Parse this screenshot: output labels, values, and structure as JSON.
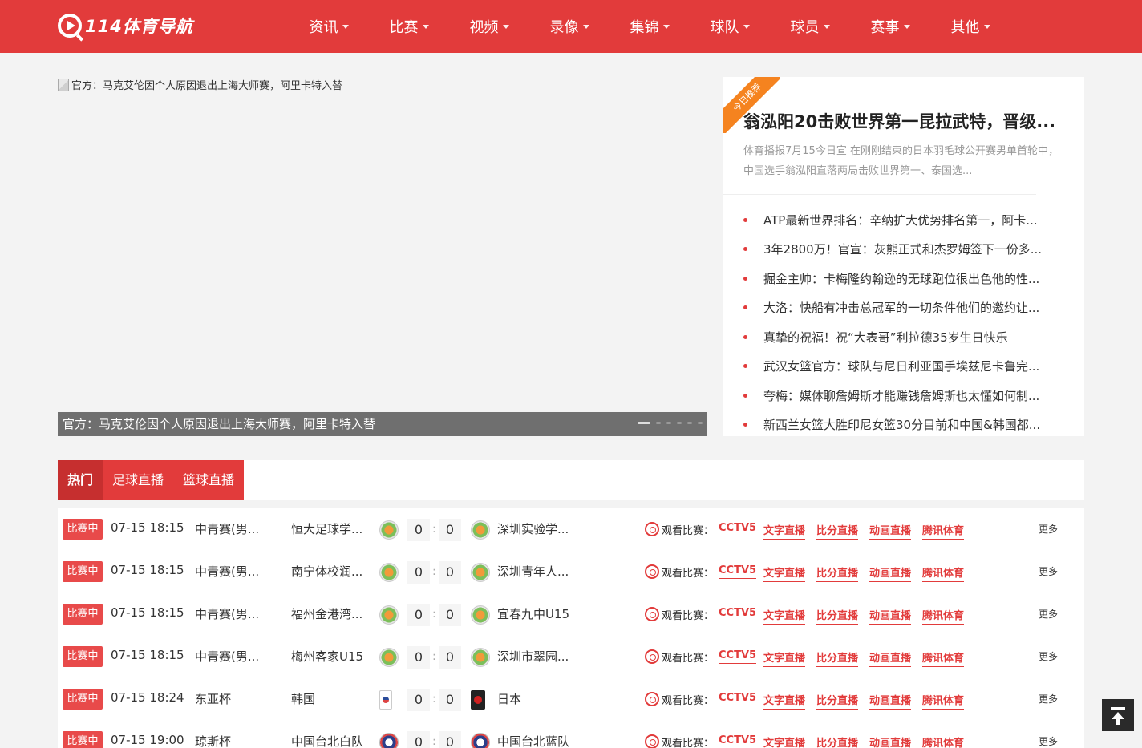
{
  "brand": {
    "logo_text": "114体育导航",
    "accent": "#e23b3b"
  },
  "nav": [
    "资讯",
    "比赛",
    "视频",
    "录像",
    "集锦",
    "球队",
    "球员",
    "赛事",
    "其他"
  ],
  "slider": {
    "image_alt": "官方：马克艾伦因个人原因退出上海大师赛，阿里卡特入替",
    "caption": "官方：马克艾伦因个人原因退出上海大师赛，阿里卡特入替"
  },
  "recommend": {
    "ribbon": "今日推荐",
    "title": "翁泓阳20击败世界第一昆拉武特，晋级...",
    "desc": "体育播报7月15今日宣 在刚刚结束的日本羽毛球公开赛男单首轮中，中国选手翁泓阳直落两局击败世界第一、泰国选...",
    "news": [
      "ATP最新世界排名：辛纳扩大优势排名第一，阿卡...",
      "3年2800万！官宣：灰熊正式和杰罗姆签下一份多...",
      "掘金主帅：卡梅隆约翰逊的无球跑位很出色他的性...",
      "大洛：快船有冲击总冠军的一切条件他们的邀约让...",
      "真挚的祝福！祝“大表哥”利拉德35岁生日快乐",
      "武汉女篮官方：球队与尼日利亚国手埃兹尼卡鲁完...",
      "夸梅：媒体聊詹姆斯才能赚钱詹姆斯也太懂如何制...",
      "新西兰女篮大胜印尼女篮30分目前和中国&韩国都..."
    ]
  },
  "tabs": [
    "热门",
    "足球直播",
    "篮球直播"
  ],
  "match_labels": {
    "watch": "观看比赛：",
    "more": "更多"
  },
  "channels": [
    "CCTV5",
    "文字直播",
    "比分直播",
    "动画直播",
    "腾讯体育"
  ],
  "matches": [
    {
      "status": "比赛中",
      "time": "07-15 18:15",
      "league": "中青赛(男...",
      "home": "恒大足球学...",
      "home_logo": "basketball-logo",
      "home_score": "0",
      "away_score": "0",
      "away": "深圳实验学...",
      "away_logo": "basketball-logo"
    },
    {
      "status": "比赛中",
      "time": "07-15 18:15",
      "league": "中青赛(男...",
      "home": "南宁体校润...",
      "home_logo": "basketball-logo",
      "home_score": "0",
      "away_score": "0",
      "away": "深圳青年人...",
      "away_logo": "basketball-logo"
    },
    {
      "status": "比赛中",
      "time": "07-15 18:15",
      "league": "中青赛(男...",
      "home": "福州金港湾...",
      "home_logo": "basketball-logo",
      "home_score": "0",
      "away_score": "0",
      "away": "宜春九中U15",
      "away_logo": "basketball-logo"
    },
    {
      "status": "比赛中",
      "time": "07-15 18:15",
      "league": "中青赛(男...",
      "home": "梅州客家U15",
      "home_logo": "basketball-logo",
      "home_score": "0",
      "away_score": "0",
      "away": "深圳市翠园...",
      "away_logo": "basketball-logo"
    },
    {
      "status": "比赛中",
      "time": "07-15 18:24",
      "league": "东亚杯",
      "home": "韩国",
      "home_logo": "korea-logo",
      "home_score": "0",
      "away_score": "0",
      "away": "日本",
      "away_logo": "japan-logo"
    },
    {
      "status": "比赛中",
      "time": "07-15 19:00",
      "league": "琼斯杯",
      "home": "中国台北白队",
      "home_logo": "taipei-logo",
      "home_score": "0",
      "away_score": "0",
      "away": "中国台北蓝队",
      "away_logo": "taipei-logo"
    }
  ]
}
